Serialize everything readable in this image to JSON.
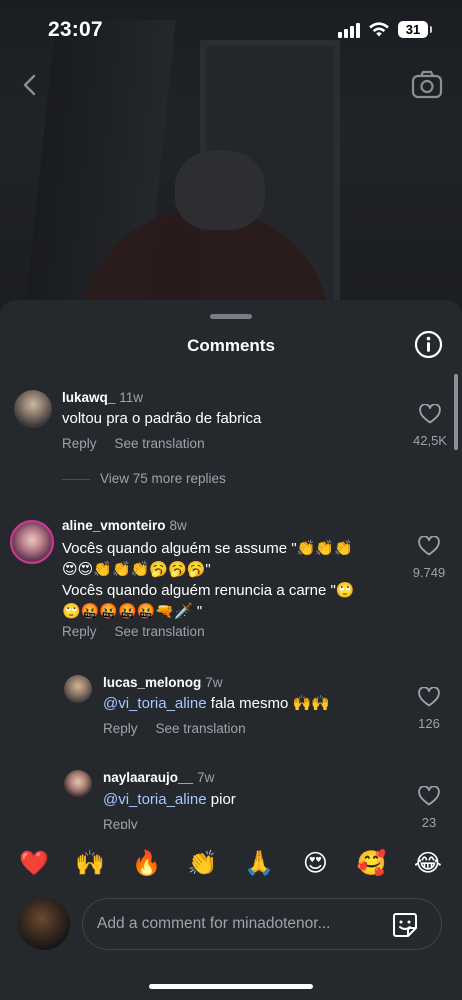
{
  "status": {
    "time": "23:07",
    "battery": "31"
  },
  "sheet": {
    "title": "Comments"
  },
  "comments": [
    {
      "username": "lukawq_",
      "age": "11w",
      "text": "voltou pra o padrão de fabrica",
      "reply": "Reply",
      "translate": "See translation",
      "likes": "42,5K",
      "view_more": "View 75 more replies"
    },
    {
      "username": "aline_vmonteiro",
      "age": "8w",
      "line1": "Vocês quando alguém se assume \"",
      "line1_emoji": "👏👏👏",
      "line2_emoji": "😍😍👏👏👏🥱🥱🥱",
      "line2_end": "\"",
      "line3": "Vocês quando alguém renuncia a carne \"",
      "line3_emoji": "🙄",
      "line4_emoji": "🙄🤬🤬🤬🤬🔫🗡️",
      "line4_end": " \"",
      "reply": "Reply",
      "translate": "See translation",
      "likes": "9.749"
    }
  ],
  "replies": [
    {
      "username": "lucas_melonog",
      "age": "7w",
      "mention": "@vi_toria_aline",
      "text": " fala mesmo ",
      "emoji": "🙌🙌",
      "reply": "Reply",
      "translate": "See translation",
      "likes": "126"
    },
    {
      "username": "naylaaraujo__",
      "age": "7w",
      "mention": "@vi_toria_aline",
      "text": " pior",
      "reply": "Reply",
      "likes": "23"
    }
  ],
  "emoji_bar": [
    "❤️",
    "🙌",
    "🔥",
    "👏",
    "🙏",
    "😍",
    "🥰",
    "😂"
  ],
  "composer": {
    "placeholder": "Add a comment for minadotenor..."
  },
  "colors": {
    "sheet_bg": "#25292e",
    "muted": "#9ea3a9",
    "mention": "#a6c8ff"
  }
}
